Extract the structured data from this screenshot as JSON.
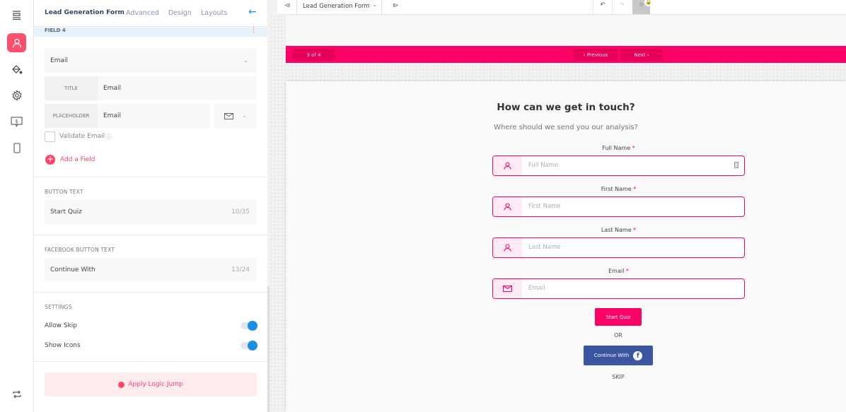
{
  "rail": {
    "icons": [
      "layout-icon",
      "user-icon",
      "paint-bucket-icon",
      "gear-icon",
      "pricing-icon",
      "mobile-icon",
      "sync-icon"
    ],
    "active": "user-icon",
    "accent": "#ff4f6e"
  },
  "panel": {
    "tabs": [
      "Lead Generation Form",
      "Advanced",
      "Design",
      "Layouts"
    ],
    "field_header": "FIELD 4",
    "field_type": "Email",
    "title_label": "TITLE",
    "title_value": "Email",
    "placeholder_label": "PLACEHOLDER",
    "placeholder_value": "Email",
    "placeholder_icon": "mail-icon",
    "validate_label": "Validate Email",
    "validate_checked": false,
    "add_field": "Add a Field",
    "button_text_label": "BUTTON TEXT",
    "button_text": "Start Quiz",
    "button_text_count": "10/35",
    "fb_label": "FACEBOOK BUTTON TEXT",
    "fb_text": "Continue With",
    "fb_count": "13/24",
    "settings_label": "SETTINGS",
    "settings": [
      {
        "label": "Allow Skip",
        "on": true
      },
      {
        "label": "Show Icons",
        "on": true
      }
    ],
    "logic_jump": "Apply Logic Jump"
  },
  "toolbar": {
    "form_select": "Lead Generation Form"
  },
  "preview": {
    "progress": "3 of 4",
    "prev": "Previous",
    "next": "Next",
    "title": "How can we get in touch?",
    "subtitle": "Where should we send you our analysis?",
    "fields": [
      {
        "label": "Full Name",
        "placeholder": "Full Name",
        "icon": "user-icon"
      },
      {
        "label": "First Name",
        "placeholder": "First Name",
        "icon": "user-icon"
      },
      {
        "label": "Last Name",
        "placeholder": "Last Name",
        "icon": "user-icon"
      },
      {
        "label": "Email",
        "placeholder": "Email",
        "icon": "mail-icon"
      }
    ],
    "required_mark": "*",
    "submit": "Start Quiz",
    "or": "OR",
    "fb_button": "Continue With",
    "skip": "SKIP",
    "brand_color": "#ff0066",
    "fb_color": "#3b55a0"
  }
}
